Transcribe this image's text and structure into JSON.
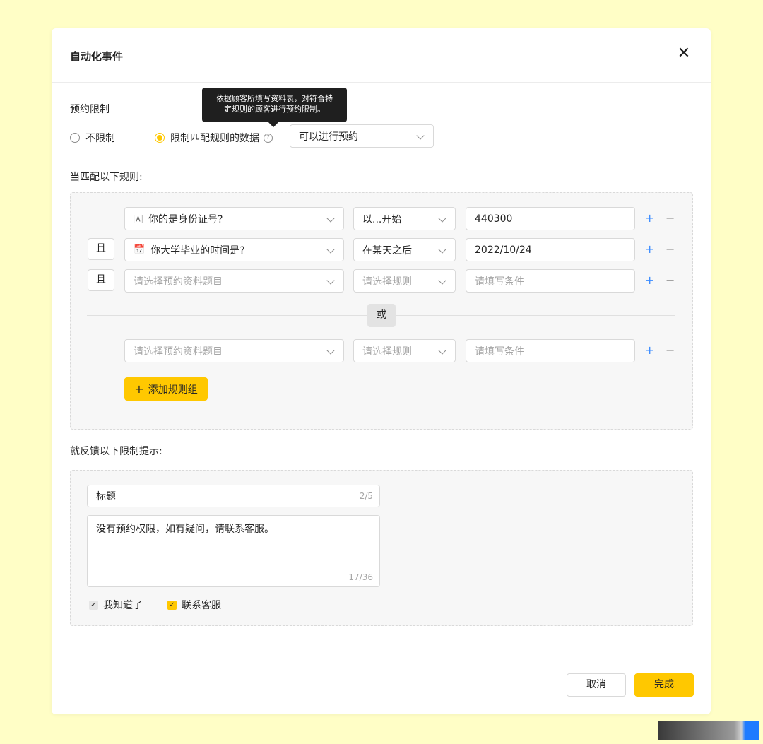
{
  "modal": {
    "title": "自动化事件",
    "close_icon": "close-icon"
  },
  "booking_limit": {
    "label": "预约限制",
    "option_unlimited": "不限制",
    "option_limited": "限制匹配规则的数据",
    "selected": "option_limited",
    "tooltip": "依据顾客所填写资料表，对符合特定规则的顾客进行预约限制。",
    "tooltip_line1": "依据顾客所填写资料表，对符合特",
    "tooltip_line2": "定规则的顾客进行预约限制。",
    "action_select": "可以进行预约"
  },
  "rules": {
    "heading": "当匹配以下规则:",
    "and_label": "且",
    "or_label": "或",
    "question_placeholder": "请选择预约资料题目",
    "rule_placeholder": "请选择规则",
    "condition_placeholder": "请填写条件",
    "group1": [
      {
        "question": "你的是身份证号?",
        "icon": "text-field-icon",
        "rule": "以...开始",
        "condition": "440300"
      },
      {
        "question": "你大学毕业的时间是?",
        "icon": "calendar-icon",
        "rule": "在某天之后",
        "condition": "2022/10/24"
      },
      {
        "question": "",
        "icon": "",
        "rule": "",
        "condition": ""
      }
    ],
    "group2": [
      {
        "question": "",
        "rule": "",
        "condition": ""
      }
    ],
    "add_group_label": "添加规则组"
  },
  "feedback": {
    "heading": "就反馈以下限制提示:",
    "title_value": "标题",
    "title_counter": "2/5",
    "message_value": "没有预约权限，如有疑问，请联系客服。",
    "message_counter": "17/36",
    "check_ack_label": "我知道了",
    "check_ack_checked": true,
    "check_contact_label": "联系客服",
    "check_contact_checked": true
  },
  "footer": {
    "cancel_label": "取消",
    "ok_label": "完成"
  },
  "colors": {
    "accent": "#ffc800",
    "link_blue": "#3a8bff",
    "page_bg": "#fffec6"
  }
}
